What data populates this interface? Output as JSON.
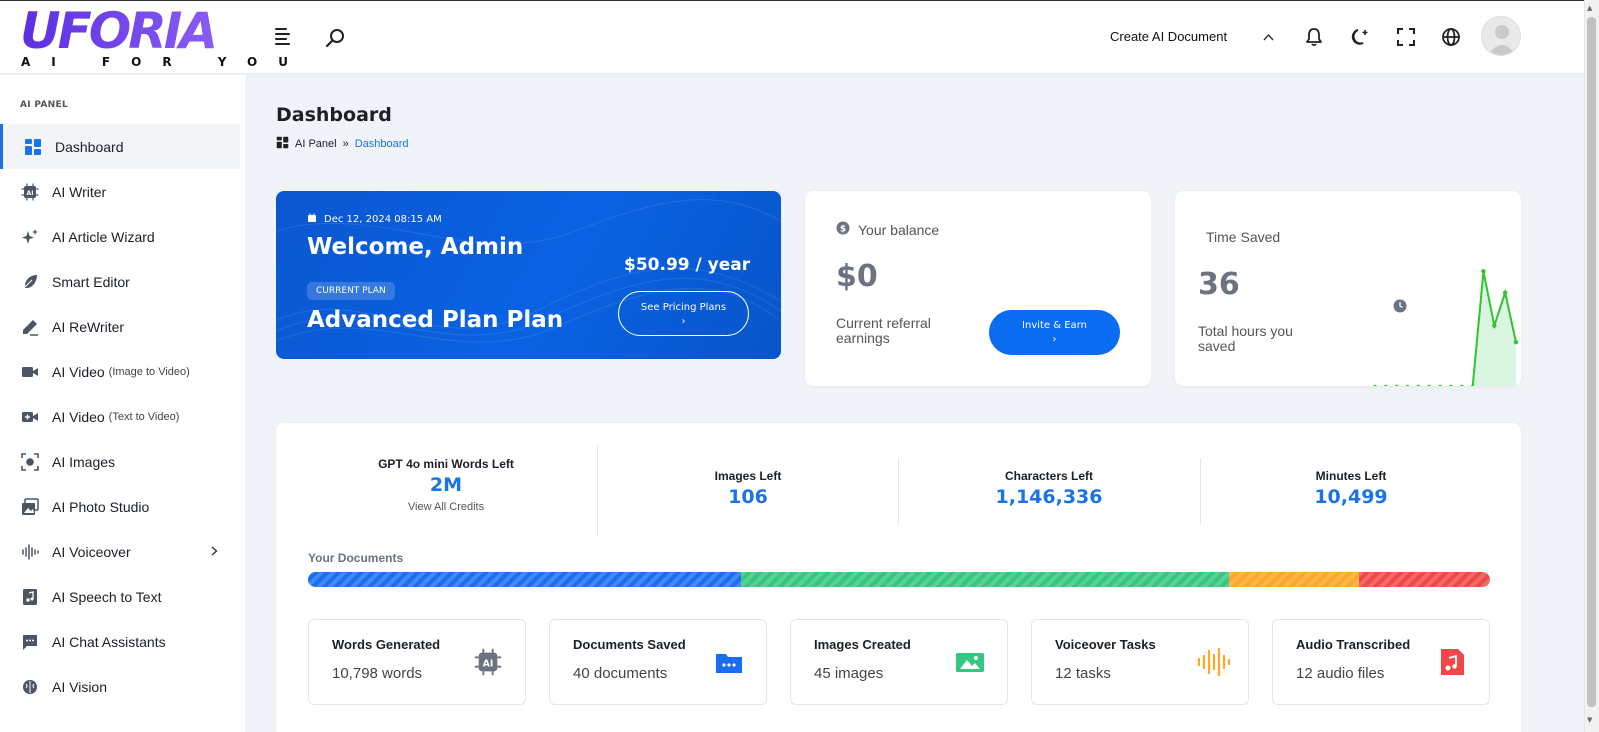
{
  "app": {
    "logo_text": "UFORIA",
    "logo_tagline": "AI FOR YOU"
  },
  "header": {
    "create_label": "Create AI Document"
  },
  "sidebar": {
    "heading": "AI PANEL",
    "items": [
      {
        "label": "Dashboard",
        "sub": "",
        "icon": "dashboard-icon"
      },
      {
        "label": "AI Writer",
        "sub": "",
        "icon": "ai-chip-icon"
      },
      {
        "label": "AI Article Wizard",
        "sub": "",
        "icon": "sparkles-icon"
      },
      {
        "label": "Smart Editor",
        "sub": "",
        "icon": "feather-icon"
      },
      {
        "label": "AI ReWriter",
        "sub": "",
        "icon": "pen-icon"
      },
      {
        "label": "AI Video",
        "sub": "(Image to Video)",
        "icon": "video-icon"
      },
      {
        "label": "AI Video",
        "sub": "(Text to Video)",
        "icon": "video-plus-icon"
      },
      {
        "label": "AI Images",
        "sub": "",
        "icon": "image-scan-icon"
      },
      {
        "label": "AI Photo Studio",
        "sub": "",
        "icon": "photos-icon"
      },
      {
        "label": "AI Voiceover",
        "sub": "",
        "icon": "waveform-icon"
      },
      {
        "label": "AI Speech to Text",
        "sub": "",
        "icon": "music-file-icon"
      },
      {
        "label": "AI Chat Assistants",
        "sub": "",
        "icon": "chat-icon"
      },
      {
        "label": "AI Vision",
        "sub": "",
        "icon": "brain-icon"
      }
    ]
  },
  "main": {
    "title": "Dashboard",
    "breadcrumb": [
      "AI Panel",
      "»",
      "Dashboard"
    ]
  },
  "welcome": {
    "date": "Dec 12, 2024 08:15 AM",
    "greeting": "Welcome, Admin",
    "plan_badge": "CURRENT PLAN",
    "plan_name": "Advanced Plan Plan",
    "price": "$50.99 / year",
    "pricing_button": "See Pricing Plans",
    "button_chevron": "›"
  },
  "balance": {
    "label": "Your balance",
    "amount": "$0",
    "description": "Current referral earnings",
    "button": "Invite & Earn",
    "button_chevron": "›"
  },
  "time_saved": {
    "label": "Time Saved",
    "value": "36",
    "description": "Total hours you saved",
    "sparkline": [
      0,
      0,
      0,
      0,
      0,
      0,
      0,
      0,
      0,
      0,
      0.98,
      0.52,
      0.8,
      0.38
    ]
  },
  "stats": {
    "items": [
      {
        "label": "GPT 4o mini Words Left",
        "value": "2M",
        "link": "View All Credits"
      },
      {
        "label": "Images Left",
        "value": "106"
      },
      {
        "label": "Characters Left",
        "value": "1,146,336"
      },
      {
        "label": "Minutes Left",
        "value": "10,499"
      }
    ],
    "documents_label": "Your Documents",
    "documents_bar": [
      {
        "share": 0.366,
        "color": "#1a6ff0"
      },
      {
        "share": 0.413,
        "color": "#33c77f"
      },
      {
        "share": 0.11,
        "color": "#ffa726"
      },
      {
        "share": 0.111,
        "color": "#f04848"
      }
    ],
    "cards": [
      {
        "title": "Words Generated",
        "value": "10,798 words",
        "icon": "ai-chip-icon",
        "color": "#6b7280"
      },
      {
        "title": "Documents Saved",
        "value": "40 documents",
        "icon": "folder-icon",
        "color": "#1a6ff0"
      },
      {
        "title": "Images Created",
        "value": "45 images",
        "icon": "image-icon",
        "color": "#33c77f"
      },
      {
        "title": "Voiceover Tasks",
        "value": "12 tasks",
        "icon": "waveform-icon",
        "color": "#ffa726"
      },
      {
        "title": "Audio Transcribed",
        "value": "12 audio files",
        "icon": "music-file-icon",
        "color": "#f04848"
      }
    ]
  }
}
